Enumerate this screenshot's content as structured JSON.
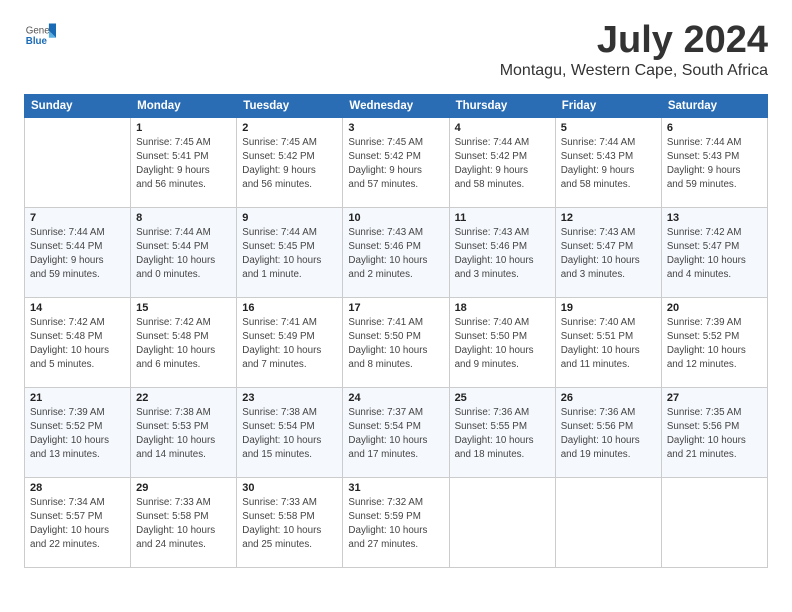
{
  "header": {
    "logo_general": "General",
    "logo_blue": "Blue",
    "month_title": "July 2024",
    "subtitle": "Montagu, Western Cape, South Africa"
  },
  "days_of_week": [
    "Sunday",
    "Monday",
    "Tuesday",
    "Wednesday",
    "Thursday",
    "Friday",
    "Saturday"
  ],
  "weeks": [
    [
      {
        "day": "",
        "info": ""
      },
      {
        "day": "1",
        "info": "Sunrise: 7:45 AM\nSunset: 5:41 PM\nDaylight: 9 hours\nand 56 minutes."
      },
      {
        "day": "2",
        "info": "Sunrise: 7:45 AM\nSunset: 5:42 PM\nDaylight: 9 hours\nand 56 minutes."
      },
      {
        "day": "3",
        "info": "Sunrise: 7:45 AM\nSunset: 5:42 PM\nDaylight: 9 hours\nand 57 minutes."
      },
      {
        "day": "4",
        "info": "Sunrise: 7:44 AM\nSunset: 5:42 PM\nDaylight: 9 hours\nand 58 minutes."
      },
      {
        "day": "5",
        "info": "Sunrise: 7:44 AM\nSunset: 5:43 PM\nDaylight: 9 hours\nand 58 minutes."
      },
      {
        "day": "6",
        "info": "Sunrise: 7:44 AM\nSunset: 5:43 PM\nDaylight: 9 hours\nand 59 minutes."
      }
    ],
    [
      {
        "day": "7",
        "info": "Sunrise: 7:44 AM\nSunset: 5:44 PM\nDaylight: 9 hours\nand 59 minutes."
      },
      {
        "day": "8",
        "info": "Sunrise: 7:44 AM\nSunset: 5:44 PM\nDaylight: 10 hours\nand 0 minutes."
      },
      {
        "day": "9",
        "info": "Sunrise: 7:44 AM\nSunset: 5:45 PM\nDaylight: 10 hours\nand 1 minute."
      },
      {
        "day": "10",
        "info": "Sunrise: 7:43 AM\nSunset: 5:46 PM\nDaylight: 10 hours\nand 2 minutes."
      },
      {
        "day": "11",
        "info": "Sunrise: 7:43 AM\nSunset: 5:46 PM\nDaylight: 10 hours\nand 3 minutes."
      },
      {
        "day": "12",
        "info": "Sunrise: 7:43 AM\nSunset: 5:47 PM\nDaylight: 10 hours\nand 3 minutes."
      },
      {
        "day": "13",
        "info": "Sunrise: 7:42 AM\nSunset: 5:47 PM\nDaylight: 10 hours\nand 4 minutes."
      }
    ],
    [
      {
        "day": "14",
        "info": "Sunrise: 7:42 AM\nSunset: 5:48 PM\nDaylight: 10 hours\nand 5 minutes."
      },
      {
        "day": "15",
        "info": "Sunrise: 7:42 AM\nSunset: 5:48 PM\nDaylight: 10 hours\nand 6 minutes."
      },
      {
        "day": "16",
        "info": "Sunrise: 7:41 AM\nSunset: 5:49 PM\nDaylight: 10 hours\nand 7 minutes."
      },
      {
        "day": "17",
        "info": "Sunrise: 7:41 AM\nSunset: 5:50 PM\nDaylight: 10 hours\nand 8 minutes."
      },
      {
        "day": "18",
        "info": "Sunrise: 7:40 AM\nSunset: 5:50 PM\nDaylight: 10 hours\nand 9 minutes."
      },
      {
        "day": "19",
        "info": "Sunrise: 7:40 AM\nSunset: 5:51 PM\nDaylight: 10 hours\nand 11 minutes."
      },
      {
        "day": "20",
        "info": "Sunrise: 7:39 AM\nSunset: 5:52 PM\nDaylight: 10 hours\nand 12 minutes."
      }
    ],
    [
      {
        "day": "21",
        "info": "Sunrise: 7:39 AM\nSunset: 5:52 PM\nDaylight: 10 hours\nand 13 minutes."
      },
      {
        "day": "22",
        "info": "Sunrise: 7:38 AM\nSunset: 5:53 PM\nDaylight: 10 hours\nand 14 minutes."
      },
      {
        "day": "23",
        "info": "Sunrise: 7:38 AM\nSunset: 5:54 PM\nDaylight: 10 hours\nand 15 minutes."
      },
      {
        "day": "24",
        "info": "Sunrise: 7:37 AM\nSunset: 5:54 PM\nDaylight: 10 hours\nand 17 minutes."
      },
      {
        "day": "25",
        "info": "Sunrise: 7:36 AM\nSunset: 5:55 PM\nDaylight: 10 hours\nand 18 minutes."
      },
      {
        "day": "26",
        "info": "Sunrise: 7:36 AM\nSunset: 5:56 PM\nDaylight: 10 hours\nand 19 minutes."
      },
      {
        "day": "27",
        "info": "Sunrise: 7:35 AM\nSunset: 5:56 PM\nDaylight: 10 hours\nand 21 minutes."
      }
    ],
    [
      {
        "day": "28",
        "info": "Sunrise: 7:34 AM\nSunset: 5:57 PM\nDaylight: 10 hours\nand 22 minutes."
      },
      {
        "day": "29",
        "info": "Sunrise: 7:33 AM\nSunset: 5:58 PM\nDaylight: 10 hours\nand 24 minutes."
      },
      {
        "day": "30",
        "info": "Sunrise: 7:33 AM\nSunset: 5:58 PM\nDaylight: 10 hours\nand 25 minutes."
      },
      {
        "day": "31",
        "info": "Sunrise: 7:32 AM\nSunset: 5:59 PM\nDaylight: 10 hours\nand 27 minutes."
      },
      {
        "day": "",
        "info": ""
      },
      {
        "day": "",
        "info": ""
      },
      {
        "day": "",
        "info": ""
      }
    ]
  ]
}
